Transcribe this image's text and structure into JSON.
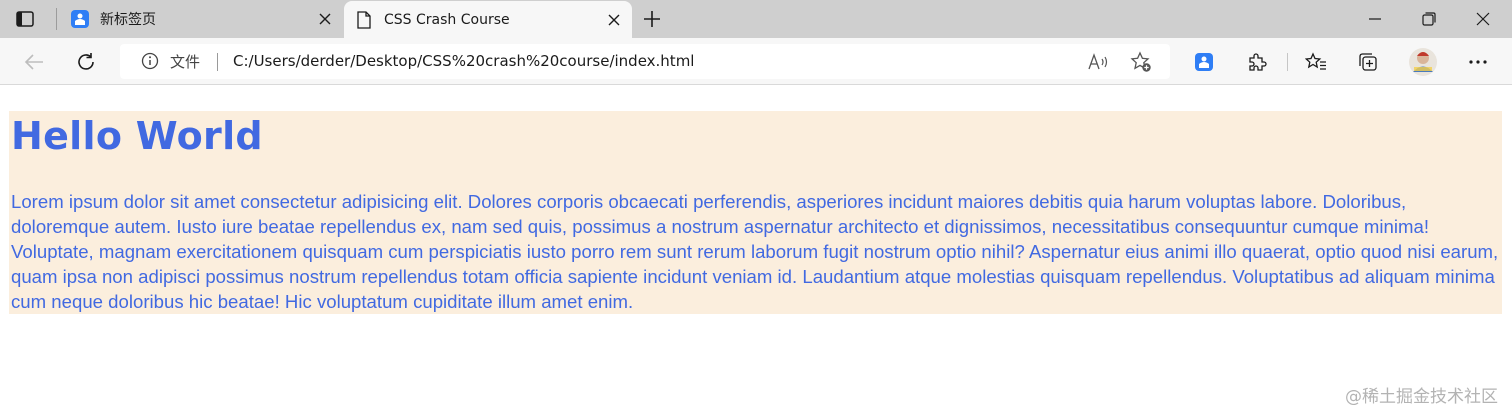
{
  "tabs": [
    {
      "title": "新标签页",
      "active": false
    },
    {
      "title": "CSS Crash Course",
      "active": true
    }
  ],
  "address_bar": {
    "scheme_label": "文件",
    "url": "C:/Users/derder/Desktop/CSS%20crash%20course/index.html"
  },
  "page": {
    "heading": "Hello World",
    "paragraph": "Lorem ipsum dolor sit amet consectetur adipisicing elit. Dolores corporis obcaecati perferendis, asperiores incidunt maiores debitis quia harum voluptas labore. Doloribus, doloremque autem. Iusto iure beatae repellendus ex, nam sed quis, possimus a nostrum aspernatur architecto et dignissimos, necessitatibus consequuntur cumque minima! Voluptate, magnam exercitationem quisquam cum perspiciatis iusto porro rem sunt rerum laborum fugit nostrum optio nihil? Aspernatur eius animi illo quaerat, optio quod nisi earum, quam ipsa non adipisci possimus nostrum repellendus totam officia sapiente incidunt veniam id. Laudantium atque molestias quisquam repellendus. Voluptatibus ad aliquam minima cum neque doloribus hic beatae! Hic voluptatum cupiditate illum amet enim.",
    "heading_color": "#4169e1",
    "background_color": "#fbeedd"
  },
  "watermark": "@稀土掘金技术社区",
  "icons": {
    "tab_actions": "tab-actions-icon",
    "new_tab_favicon": "new-tab-favicon",
    "page_favicon": "document-icon",
    "close": "close-icon",
    "new_tab": "plus-icon",
    "minimize": "minimize-icon",
    "restore": "restore-icon",
    "window_close": "window-close-icon",
    "back": "back-arrow-icon",
    "refresh": "refresh-icon",
    "info": "info-icon",
    "read_aloud": "read-aloud-icon",
    "add_favorite": "add-favorite-icon",
    "extension_app": "extension-app-icon",
    "extensions": "puzzle-icon",
    "favorites": "favorites-icon",
    "collections": "collections-icon",
    "profile": "profile-avatar",
    "more": "more-icon"
  }
}
